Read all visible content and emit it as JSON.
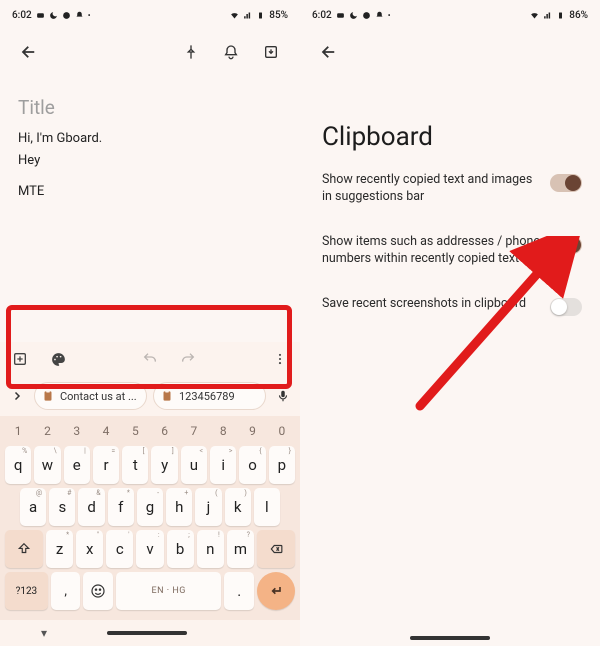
{
  "left": {
    "status": {
      "time": "6:02",
      "battery": "85%"
    },
    "title_placeholder": "Title",
    "body_line1": "Hi, I'm Gboard.",
    "body_line2": "Hey",
    "body_line3": "MTE",
    "clipbar": {
      "pill1": "Contact us at ...",
      "pill2": "123456789"
    },
    "keyboard": {
      "numrow": [
        "1",
        "2",
        "3",
        "4",
        "5",
        "6",
        "7",
        "8",
        "9",
        "0"
      ],
      "row1": [
        "q",
        "w",
        "e",
        "r",
        "t",
        "y",
        "u",
        "i",
        "o",
        "p"
      ],
      "row2": [
        "a",
        "s",
        "d",
        "f",
        "g",
        "h",
        "j",
        "k",
        "l"
      ],
      "row3": [
        "z",
        "x",
        "c",
        "v",
        "b",
        "n",
        "m"
      ],
      "symKey": "?123",
      "spaceLabel": "EN · HG"
    }
  },
  "right": {
    "status": {
      "time": "6:02",
      "battery": "86%"
    },
    "title": "Clipboard",
    "settings": [
      {
        "label": "Show recently copied text and images in suggestions bar",
        "on": true
      },
      {
        "label": "Show items such as addresses / phone numbers within recently copied text",
        "on": true
      },
      {
        "label": "Save recent screenshots in clipboard",
        "on": false
      }
    ]
  }
}
